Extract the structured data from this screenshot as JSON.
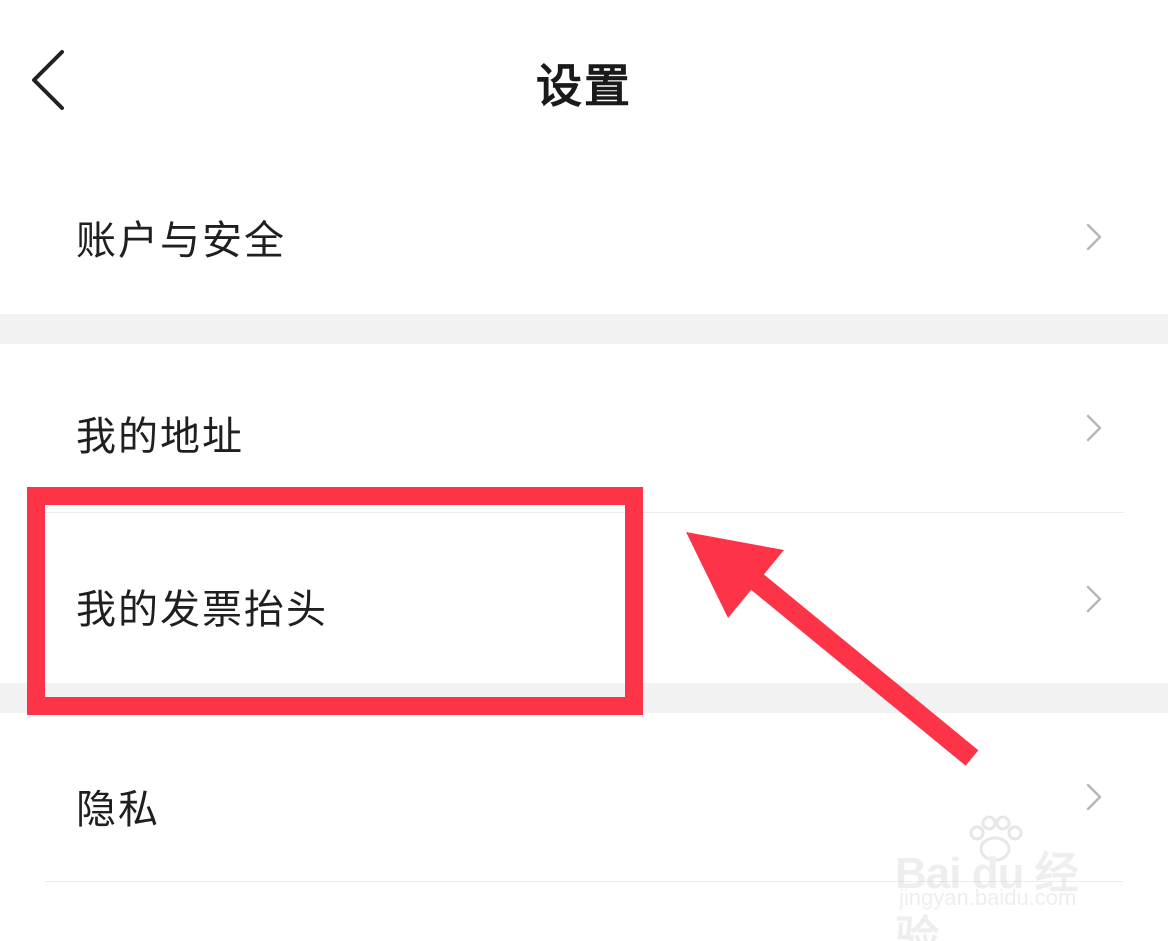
{
  "header": {
    "title": "设置",
    "back_icon": "chevron-left-icon"
  },
  "settings": {
    "items": [
      {
        "label": "账户与安全",
        "icon": "chevron-right-icon"
      },
      {
        "label": "我的地址",
        "icon": "chevron-right-icon"
      },
      {
        "label": "我的发票抬头",
        "icon": "chevron-right-icon"
      },
      {
        "label": "隐私",
        "icon": "chevron-right-icon"
      }
    ]
  },
  "annotation": {
    "highlight_color": "#fd3448",
    "highlighted_item": "我的发票抬头"
  },
  "watermark": {
    "logo": "Bai du 经验",
    "url": "jingyan.baidu.com"
  },
  "colors": {
    "background": "#ffffff",
    "separator": "#f2f2f2",
    "text": "#1f1f1f",
    "chevron": "#b8b8b8"
  }
}
